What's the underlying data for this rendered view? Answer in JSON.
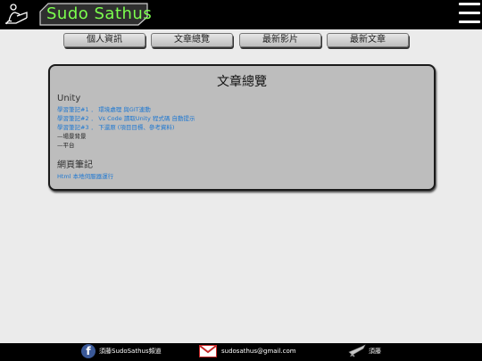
{
  "header": {
    "logo_text": "Sudo Sathus",
    "reader_icon": "reading-person-icon",
    "menu_icon": "hamburger-menu-icon"
  },
  "nav": {
    "items": [
      "個人資訊",
      "文章總覽",
      "最新影片",
      "最新文章"
    ]
  },
  "main": {
    "title": "文章總覽",
    "sections": [
      {
        "heading": "Unity",
        "links": [
          "學習筆記#1 ． 環境處理 與GIT連動",
          "學習筆記#2 ． Vs Code 讀取Unity 程式碼 自動提示",
          "學習筆記#3 ． 下還原 (項目目標、參考資料)"
        ],
        "notes": [
          "—場景背景",
          "—平台"
        ]
      },
      {
        "heading": "網頁筆記",
        "links": [
          "Html 本地伺服器運行"
        ]
      }
    ]
  },
  "footer": {
    "facebook_label": "須藤SudoSathus頻道",
    "email": "sudosathus@gmail.com",
    "sword_label": "須藤",
    "icons": [
      "facebook-icon",
      "gmail-icon",
      "sword-icon"
    ]
  },
  "colors": {
    "topbar": "#000000",
    "logo_text": "#7cff4e",
    "link": "#1e78d2",
    "panel_bg": "#bdbdbd"
  }
}
